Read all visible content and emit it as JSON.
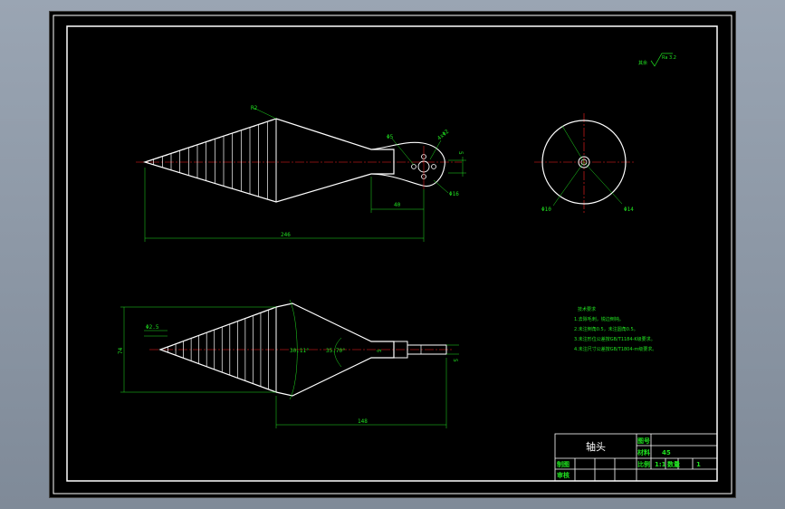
{
  "roughness": {
    "label": "其余",
    "value": "Ra 3.2"
  },
  "top_view": {
    "radius_label": "R2",
    "hole_label": "Φ5",
    "hole_pattern_label": "4xΦ2",
    "flange_label": "Φ16",
    "dim_40": "40",
    "dim_246": "246",
    "dim_side": "5"
  },
  "end_view": {
    "inner_label": "Φ10",
    "outer_label": "Φ14"
  },
  "front_view": {
    "pitch_label": "Φ2.5",
    "height_label": "74",
    "angle_left": "30.11°",
    "angle_right": "35.70°",
    "neck_label": "5",
    "dim_148": "148",
    "tip_label": "5"
  },
  "tech_notes": {
    "title": "技术要求",
    "items": [
      "1.去除毛刺，锐边倒钝。",
      "2.未注倒角0.5，未注圆角0.5。",
      "3.未注形位公差按GB/T1184-K级要求。",
      "4.未注尺寸公差按GB/T1804-m级要求。"
    ]
  },
  "title_block": {
    "part_name": "轴头",
    "drawing_no_label": "图号",
    "material_label": "材料",
    "material_value": "45",
    "scale_label": "比例",
    "scale_value": "1:1",
    "qty_label": "数量",
    "qty_value": "1",
    "drawn_label": "制图",
    "check_label": "审核"
  }
}
